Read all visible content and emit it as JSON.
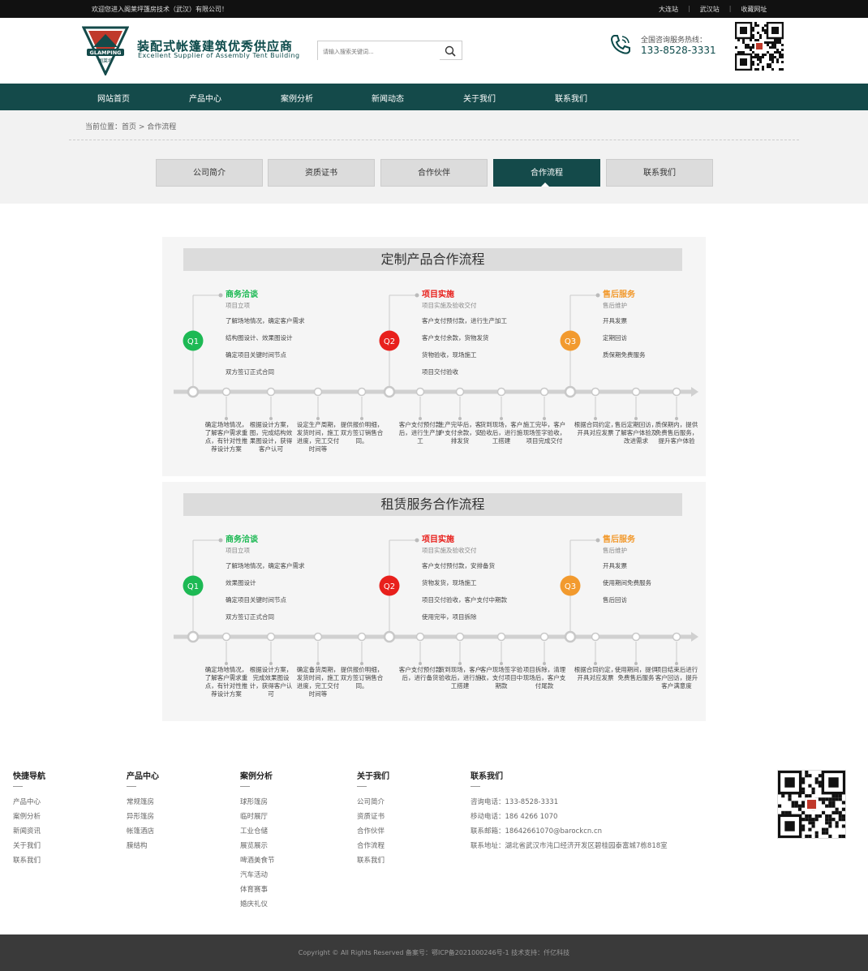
{
  "topbar": {
    "welcome": "欢迎您进入阁莱坪篷房技术（武汉）有限公司！",
    "links": [
      "大连站",
      "武汉站",
      "收藏网址"
    ]
  },
  "header": {
    "logo_text": "GLAMPING",
    "logo_sub": "阁莱坪",
    "brand_cn": "装配式帐篷建筑优秀供应商",
    "brand_en": "Excellent Supplier of Assembly Tent Building",
    "search_placeholder": "请输入搜索关键词...",
    "hotline_label": "全国咨询服务热线：",
    "hotline": "133-8528-3331"
  },
  "nav": [
    "网站首页",
    "产品中心",
    "案例分析",
    "新闻动态",
    "关于我们",
    "联系我们"
  ],
  "breadcrumb": "当前位置：首页 > 合作流程",
  "tabs": [
    "公司简介",
    "资质证书",
    "合作伙伴",
    "合作流程",
    "联系我们"
  ],
  "active_tab": 3,
  "processes": [
    {
      "title": "定制产品合作流程",
      "phases": [
        {
          "badge": "Q1",
          "title": "商务洽谈",
          "sub": "项目立项",
          "color": "#1db954",
          "items": [
            "了解场地情况，确定客户需求",
            "结构图设计、效果图设计",
            "确定项目关键时间节点",
            "双方签订正式合同"
          ]
        },
        {
          "badge": "Q2",
          "title": "项目实施",
          "sub": "项目实施及验收交付",
          "color": "#e8201c",
          "items": [
            "客户支付预付款，进行生产加工",
            "客户支付余款，货物发货",
            "货物验收，现场施工",
            "项目交付验收"
          ]
        },
        {
          "badge": "Q3",
          "title": "售后服务",
          "sub": "售后维护",
          "color": "#f29a2e",
          "items": [
            "开具发票",
            "定期回访",
            "质保期免费服务"
          ]
        }
      ],
      "bottom": [
        "确定场地情况，了解客户需求重点，有针对性推荐设计方案",
        "根据设计方案，图，完成结构效果图设计，获得客户认可",
        "设定生产周期，发货时间，施工进度，完工交付时间等",
        "提供报价明细，双方签订销售合同。",
        "客户支付预付款后，进行生产加工",
        "生产完毕后，客户支付余款，安排发货",
        "货到现场，客户验收后，进行施工搭建",
        "施工完毕，客户现场签字验收，项目完成交付",
        "根据合同约定，开具对应发票",
        "售后定期回访，了解客户体验及改进需求",
        "质保期内，提供免费售后服务，提升客户体验"
      ]
    },
    {
      "title": "租赁服务合作流程",
      "phases": [
        {
          "badge": "Q1",
          "title": "商务洽谈",
          "sub": "项目立项",
          "color": "#1db954",
          "items": [
            "了解场地情况，确定客户需求",
            "效果图设计",
            "确定项目关键时间节点",
            "双方签订正式合同"
          ]
        },
        {
          "badge": "Q2",
          "title": "项目实施",
          "sub": "项目实施及验收交付",
          "color": "#e8201c",
          "items": [
            "客户支付预付款，安排备货",
            "货物发货，现场施工",
            "项目交付验收，客户支付中期款",
            "使用完毕，项目拆除"
          ]
        },
        {
          "badge": "Q3",
          "title": "售后服务",
          "sub": "售后维护",
          "color": "#f29a2e",
          "items": [
            "开具发票",
            "使用期间免费服务",
            "售后回访"
          ]
        }
      ],
      "bottom": [
        "确定场地情况，了解客户需求重点，有针对性推荐设计方案",
        "根据设计方案，完成效果图设计，获得客户认可",
        "确定备货周期，发货时间，施工进度，完工交付时间等",
        "提供报价明细，双方签订销售合同。",
        "客户支付预付款后，进行备货",
        "货到现场，客户验收后，进行施工搭建",
        "客户现场签字验收，支付项目中期款",
        "项目拆除，清理现场后，客户支付尾款",
        "根据合同约定，开具对应发票",
        "使用期间，提供免费售后服务",
        "项目结束后进行客户回访，提升客户满意度"
      ]
    }
  ],
  "footer": {
    "cols": [
      {
        "title": "快捷导航",
        "items": [
          "产品中心",
          "案例分析",
          "新闻资讯",
          "关于我们",
          "联系我们"
        ]
      },
      {
        "title": "产品中心",
        "items": [
          "常规篷房",
          "异形篷房",
          "帐篷酒店",
          "膜结构"
        ]
      },
      {
        "title": "案例分析",
        "items": [
          "球形篷房",
          "临时展厅",
          "工业仓储",
          "展览展示",
          "啤酒美食节",
          "汽车活动",
          "体育赛事",
          "婚庆礼仪"
        ]
      },
      {
        "title": "关于我们",
        "items": [
          "公司简介",
          "资质证书",
          "合作伙伴",
          "合作流程",
          "联系我们"
        ]
      },
      {
        "title": "联系我们",
        "items": [
          "咨询电话：133-8528-3331",
          "移动电话：186 4266 1070",
          "联系邮箱：18642661070@barockcn.cn",
          "联系地址：湖北省武汉市沌口经济开发区碧桂园泰富城7栋818室"
        ]
      }
    ],
    "copyright": "Copyright © All Rights Reserved 备案号：鄂ICP备2021000246号-1 技术支持：仟亿科技"
  },
  "colors": {
    "brand": "#144a4a",
    "q1": "#1db954",
    "q2": "#e8201c",
    "q3": "#f29a2e"
  }
}
